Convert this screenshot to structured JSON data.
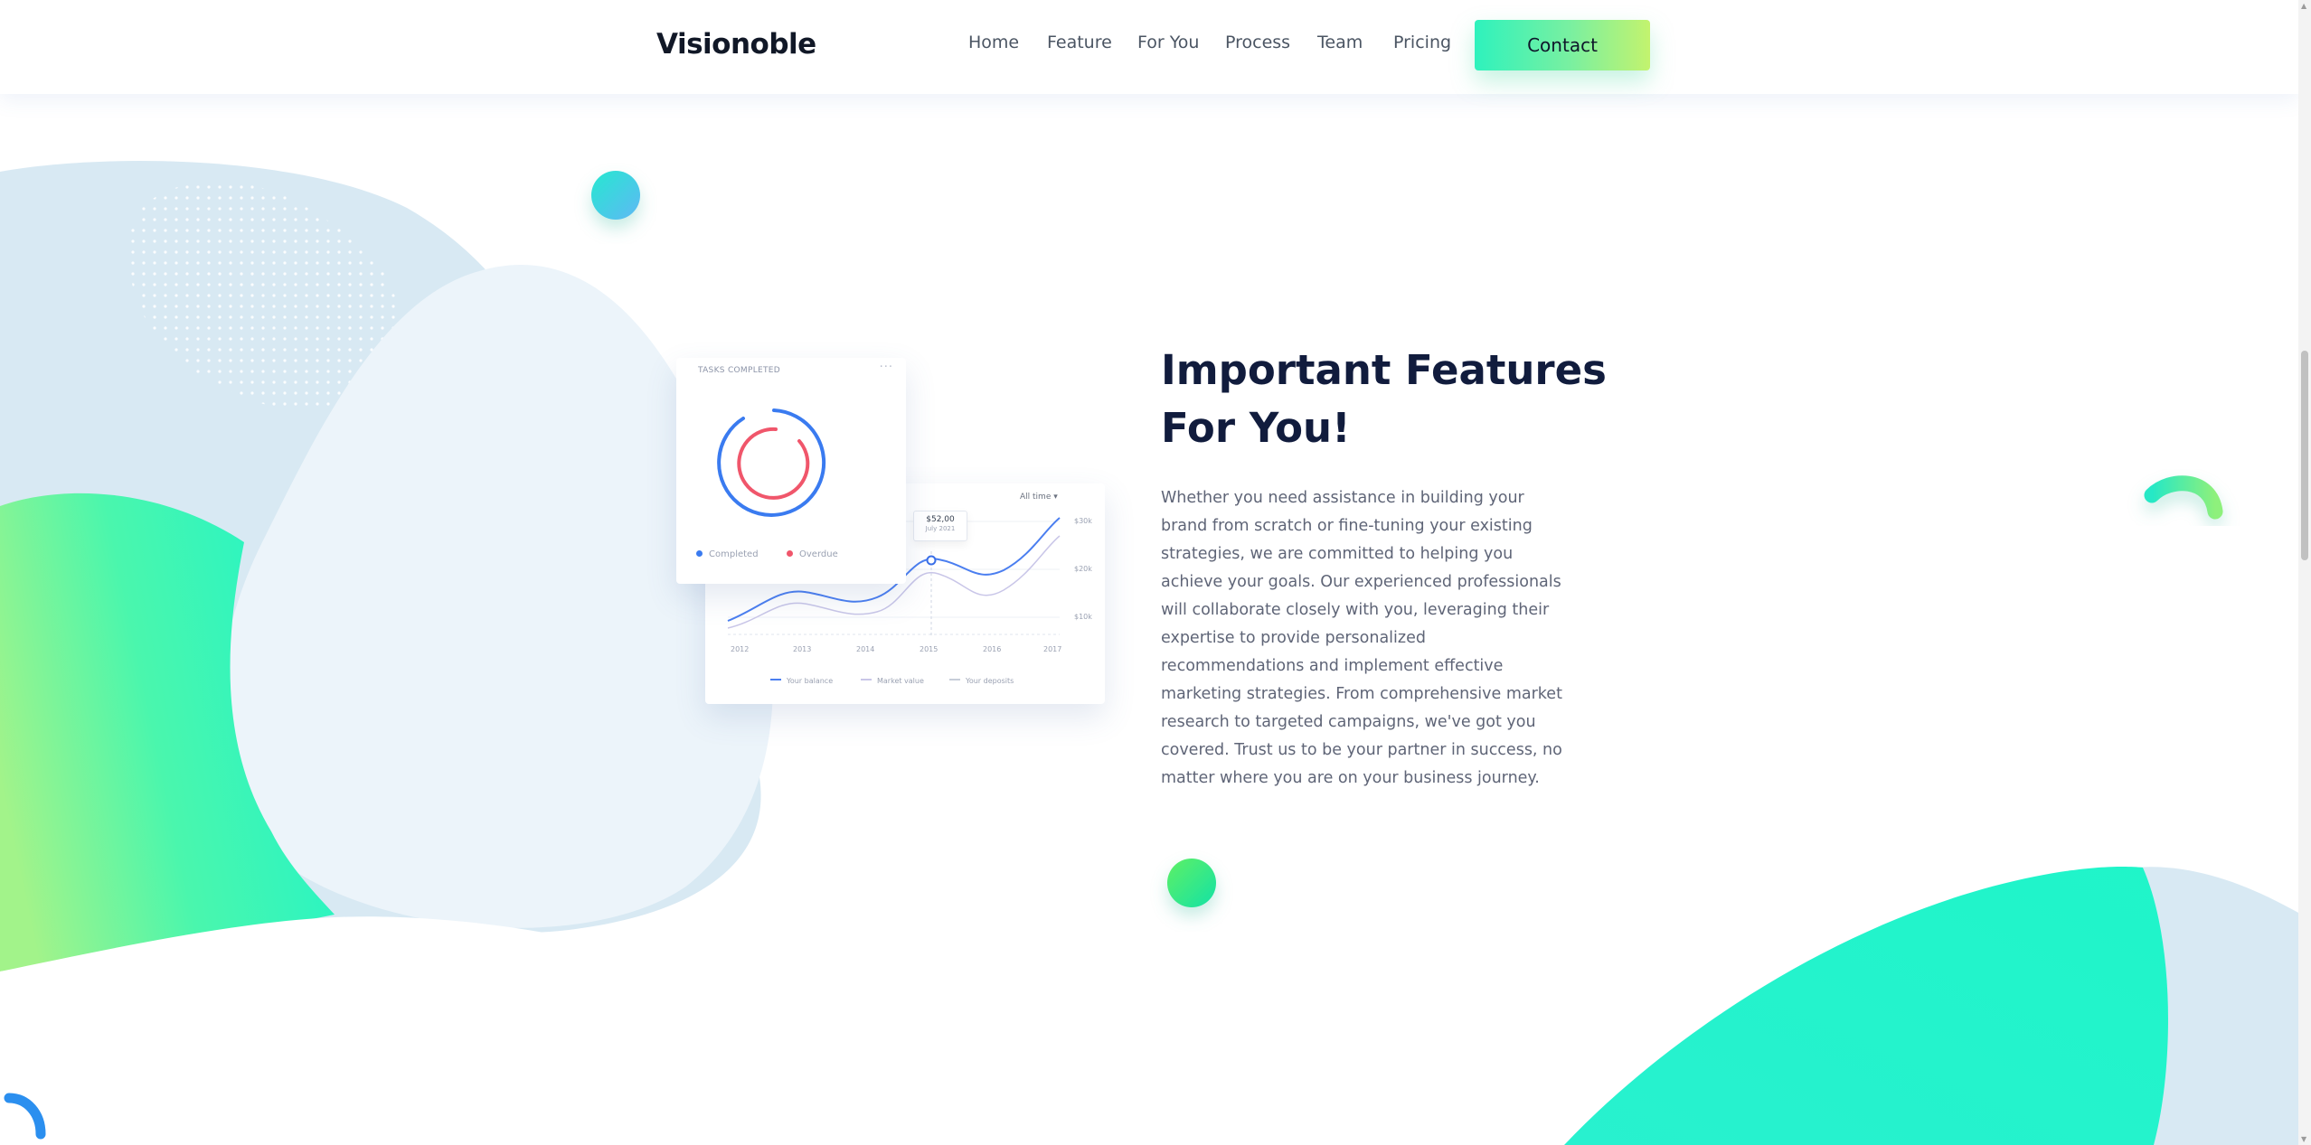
{
  "header": {
    "logo": "Visionoble",
    "nav": [
      "Home",
      "Feature",
      "For You",
      "Process",
      "Team",
      "Pricing"
    ],
    "contact_label": "Contact"
  },
  "dashboard": {
    "tasks": {
      "title": "TASKS COMPLETED",
      "completed_label": "Completed",
      "overdue_label": "Overdue",
      "completed_color": "#3a7bf0",
      "overdue_color": "#f0566b"
    },
    "line_chart": {
      "range_label": "All time",
      "tooltip_value": "$52,00",
      "tooltip_date": "July 2021",
      "y_ticks": [
        "$30k",
        "$20k",
        "$10k"
      ],
      "x_ticks": [
        "2012",
        "2013",
        "2014",
        "2015",
        "2016",
        "2017"
      ],
      "legend": [
        "Your balance",
        "Market value",
        "Your deposits"
      ]
    }
  },
  "features": {
    "heading_line1": "Important Features",
    "heading_line2": "For You!",
    "description": "Whether you need assistance in building your brand from scratch or fine-tuning your existing strategies, we are committed to helping you achieve your goals. Our experienced professionals will collaborate closely with you, leveraging their expertise to provide personalized recommendations and implement effective marketing strategies. From comprehensive market research to targeted campaigns, we've got you covered. Trust us to be your partner in success, no matter where you are on your business journey."
  },
  "colors": {
    "accent_green": "#2ef2bd",
    "accent_lime": "#c3f36e",
    "heading": "#111c3d",
    "blob_light": "#eaf3fa",
    "blob_blue": "#d7e8f2"
  }
}
